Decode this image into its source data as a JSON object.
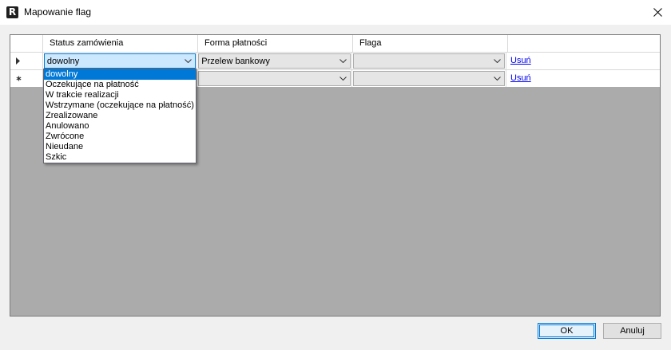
{
  "window": {
    "app_icon_letter": "R",
    "title": "Mapowanie flag"
  },
  "grid": {
    "columns": [
      "Status zamówienia",
      "Forma płatności",
      "Flaga"
    ],
    "rows": [
      {
        "row_header": "current",
        "status": "dowolny",
        "payment": "Przelew bankowy",
        "flag": "",
        "action": "Usuń"
      },
      {
        "row_header": "new",
        "status": "",
        "payment": "",
        "flag": "",
        "action": "Usuń"
      }
    ]
  },
  "status_dropdown": {
    "options": [
      "dowolny",
      "Oczekujące na płatność",
      "W trakcie realizacji",
      "Wstrzymane (oczekujące na płatność)",
      "Zrealizowane",
      "Anulowano",
      "Zwrócone",
      "Nieudane",
      "Szkic"
    ],
    "selected": "dowolny"
  },
  "buttons": {
    "ok": "OK",
    "cancel": "Anuluj"
  },
  "colors": {
    "grid_background": "#ababab",
    "selection": "#0078d7",
    "link": "#0000ee"
  }
}
